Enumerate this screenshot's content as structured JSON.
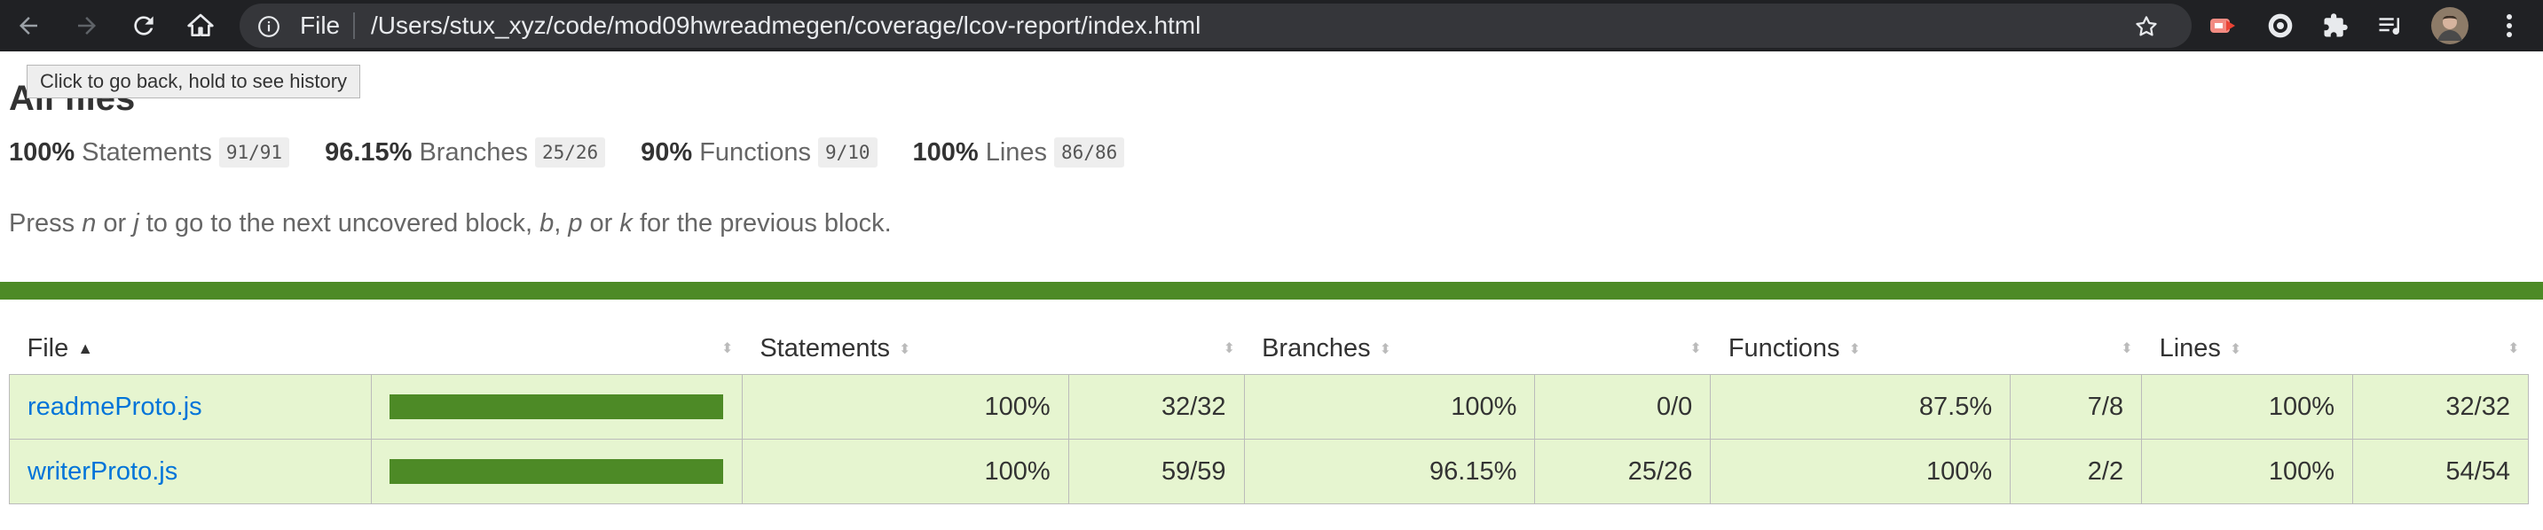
{
  "browser": {
    "scheme_label": "File",
    "url": "/Users/stux_xyz/code/mod09hwreadmegen/coverage/lcov-report/index.html",
    "tooltip": "Click to go back, hold to see history",
    "icons": [
      "back-icon",
      "forward-icon",
      "reload-icon",
      "home-icon",
      "info-icon",
      "star-icon",
      "extension-icon",
      "puzzle-icon",
      "media-queue-icon",
      "avatar",
      "more-icon"
    ]
  },
  "page": {
    "title": "All files",
    "hint": {
      "t1": "Press ",
      "k1": "n",
      "t2": " or ",
      "k2": "j",
      "t3": " to go to the next uncovered block, ",
      "k3": "b",
      "t4": ", ",
      "k4": "p",
      "t5": " or ",
      "k5": "k",
      "t6": " for the previous block."
    }
  },
  "summary": [
    {
      "pct": "100%",
      "label": "Statements",
      "fraction": "91/91"
    },
    {
      "pct": "96.15%",
      "label": "Branches",
      "fraction": "25/26"
    },
    {
      "pct": "90%",
      "label": "Functions",
      "fraction": "9/10"
    },
    {
      "pct": "100%",
      "label": "Lines",
      "fraction": "86/86"
    }
  ],
  "table": {
    "headers": {
      "file": "File",
      "statements": "Statements",
      "branches": "Branches",
      "functions": "Functions",
      "lines": "Lines"
    },
    "rows": [
      {
        "file": "readmeProto.js",
        "coverage_fraction": 1.0,
        "statements_pct": "100%",
        "statements_abs": "32/32",
        "branches_pct": "100%",
        "branches_abs": "0/0",
        "functions_pct": "87.5%",
        "functions_abs": "7/8",
        "lines_pct": "100%",
        "lines_abs": "32/32"
      },
      {
        "file": "writerProto.js",
        "coverage_fraction": 1.0,
        "statements_pct": "100%",
        "statements_abs": "59/59",
        "branches_pct": "96.15%",
        "branches_abs": "25/26",
        "functions_pct": "100%",
        "functions_abs": "2/2",
        "lines_pct": "100%",
        "lines_abs": "54/54"
      }
    ]
  },
  "colors": {
    "toolbar": "#202124",
    "coverage_high": "#4d8a26",
    "row_high": "#e6f5d0",
    "link": "#0074d9"
  }
}
